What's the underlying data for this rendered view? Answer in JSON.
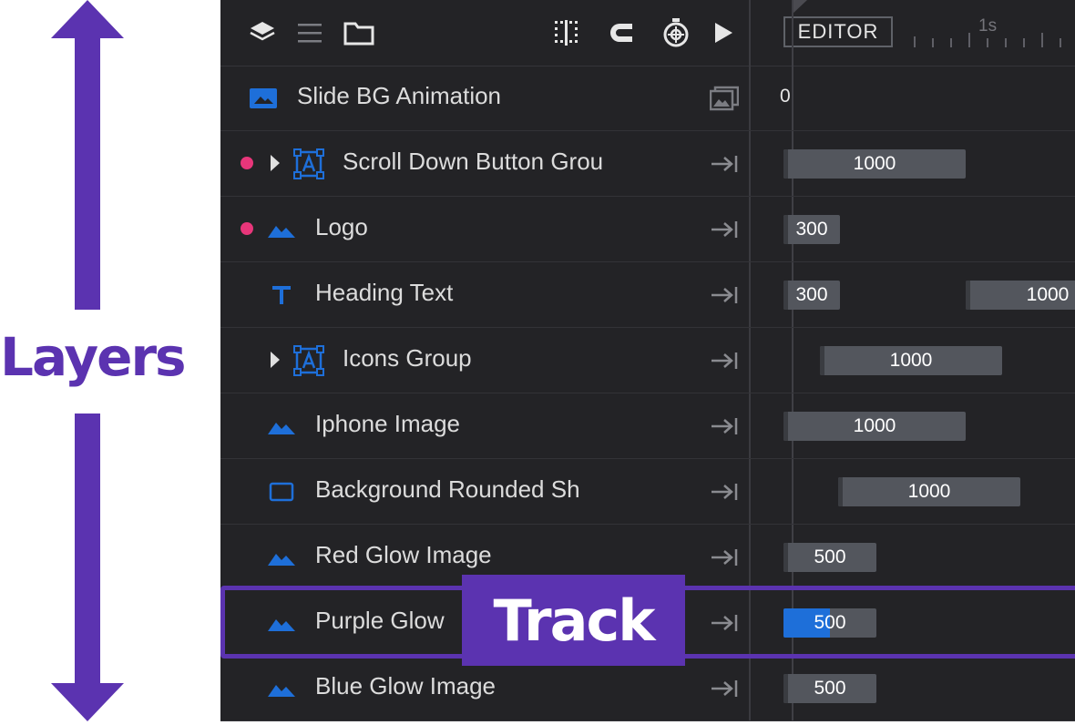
{
  "annotations": {
    "layers_label": "Layers",
    "track_label": "Track",
    "accent_color": "#5b33b0"
  },
  "toolbar": {
    "left_icons": [
      "layers-icon",
      "list-icon",
      "folder-icon"
    ],
    "right_icons": [
      "grid-snap-icon",
      "magnet-icon",
      "stopwatch-icon",
      "play-icon"
    ]
  },
  "timeline": {
    "editor_label": "EDITOR",
    "ruler_label": "1s"
  },
  "slide_bg": {
    "label": "Slide BG Animation",
    "icon": "image-icon",
    "action_icon": "images-stack-icon",
    "time_value": "0"
  },
  "layers": [
    {
      "name": "Scroll Down Button Grou",
      "icon": "group-icon",
      "marker": true,
      "expander": true,
      "bars": [
        {
          "value": "1000"
        }
      ]
    },
    {
      "name": "Logo",
      "icon": "image-icon",
      "marker": true,
      "expander": false,
      "bars": [
        {
          "value": "300"
        }
      ]
    },
    {
      "name": "Heading Text",
      "icon": "text-icon",
      "marker": false,
      "expander": false,
      "bars": [
        {
          "value": "300"
        },
        {
          "value": "1000"
        }
      ]
    },
    {
      "name": "Icons Group",
      "icon": "group-icon",
      "marker": false,
      "expander": true,
      "bars": [
        {
          "value": "1000"
        }
      ]
    },
    {
      "name": "Iphone Image",
      "icon": "image-icon",
      "marker": false,
      "expander": false,
      "bars": [
        {
          "value": "1000"
        }
      ]
    },
    {
      "name": "Background Rounded Sh",
      "icon": "shape-icon",
      "marker": false,
      "expander": false,
      "bars": [
        {
          "value": "1000"
        }
      ]
    },
    {
      "name": "Red Glow Image",
      "icon": "image-icon",
      "marker": false,
      "expander": false,
      "bars": [
        {
          "value": "500"
        }
      ]
    },
    {
      "name": "Purple Glow",
      "icon": "image-icon",
      "marker": false,
      "expander": false,
      "selected": true,
      "bars": [
        {
          "value": "500",
          "progress": 0.5
        }
      ]
    },
    {
      "name": "Blue Glow Image",
      "icon": "image-icon",
      "marker": false,
      "expander": false,
      "bars": [
        {
          "value": "500"
        }
      ]
    }
  ],
  "colors": {
    "panel_bg": "#232326",
    "bar_bg": "#53565d",
    "marker": "#e8367a",
    "icon_blue": "#1e6fd9",
    "progress": "#1e6fd9"
  }
}
